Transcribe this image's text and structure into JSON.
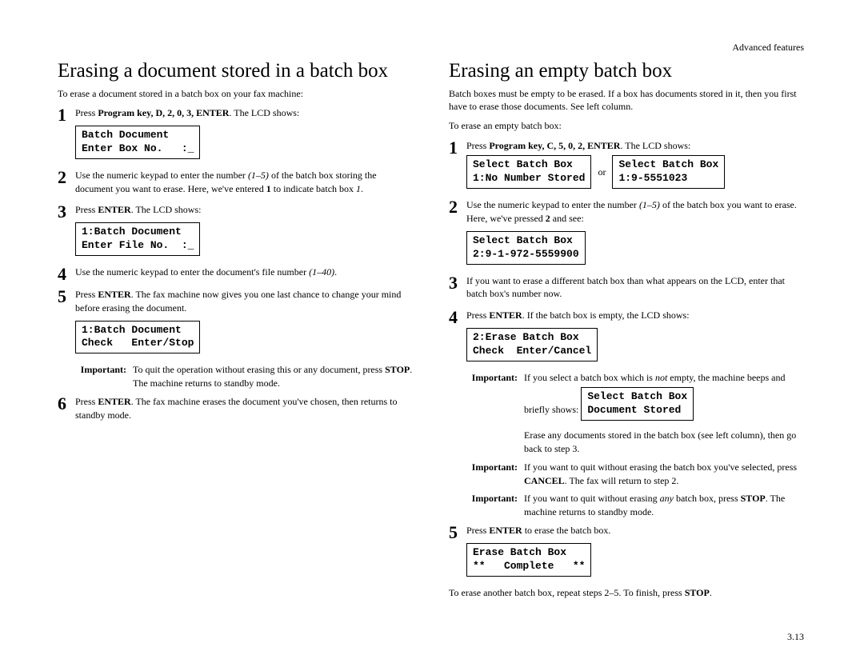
{
  "header": "Advanced features",
  "page_number": "3.13",
  "left": {
    "title": "Erasing a document stored in a batch box",
    "intro": "To erase a document stored in a batch box on your fax machine:",
    "step1_a": "Press ",
    "step1_b": "Program key, ",
    "step1_c": "D",
    "step1_d": ", 2, 0, 3, ",
    "step1_e": "ENTER",
    "step1_f": ". The ",
    "step1_g": "LCD",
    "step1_h": " shows:",
    "lcd1": "Batch Document\nEnter Box No.   :_",
    "step2_a": "Use the numeric keypad to enter the number ",
    "step2_b": "(1–5)",
    "step2_c": " of the batch box storing the document you want to erase. Here, we've entered ",
    "step2_d": "1",
    "step2_e": " to indicate batch box ",
    "step2_f": "1",
    "step2_g": ".",
    "step3_a": "Press ",
    "step3_b": "ENTER",
    "step3_c": ". The ",
    "step3_d": "LCD",
    "step3_e": " shows:",
    "lcd3": "1:Batch Document\nEnter File No.  :_",
    "step4_a": "Use the numeric keypad to enter the document's file number ",
    "step4_b": "(1–40)",
    "step4_c": ".",
    "step5_a": "Press ",
    "step5_b": "ENTER",
    "step5_c": ". The fax machine now gives you one last chance to change your mind before erasing the document.",
    "lcd5": "1:Batch Document\nCheck   Enter/Stop",
    "note1_label": "Important:",
    "note1_a": "To quit the operation without erasing this or any document, press ",
    "note1_b": "STOP",
    "note1_c": ". The machine returns to standby mode.",
    "step6_a": "Press ",
    "step6_b": "ENTER",
    "step6_c": ". The fax machine erases the document you've chosen, then returns to standby mode."
  },
  "right": {
    "title": "Erasing an empty batch box",
    "intro1": "Batch boxes must be empty to be erased. If a box has documents stored in it, then you first have to erase those documents. See left column.",
    "intro2": "To erase an empty batch box:",
    "step1_a": "Press ",
    "step1_b": "Program key, ",
    "step1_c": "C",
    "step1_d": ", 5, 0, 2, ",
    "step1_e": "ENTER",
    "step1_f": ". The ",
    "step1_g": "LCD",
    "step1_h": " shows:",
    "lcd1a": "Select Batch Box\n1:No Number Stored",
    "or": "or",
    "lcd1b": "Select Batch Box\n1:9-5551023",
    "step2_a": "Use the numeric keypad to enter the number ",
    "step2_b": "(1–5)",
    "step2_c": " of the batch box you want to erase. Here, we've pressed ",
    "step2_d": "2",
    "step2_e": " and see:",
    "lcd2": "Select Batch Box\n2:9-1-972-5559900",
    "step3_a": "If you want to erase a different batch box than what appears on the ",
    "step3_b": "LCD",
    "step3_c": ", enter that batch box's number now.",
    "step4_a": "Press ",
    "step4_b": "ENTER",
    "step4_c": ". If the batch box is empty, the ",
    "step4_d": "LCD",
    "step4_e": " shows:",
    "lcd4": "2:Erase Batch Box\nCheck  Enter/Cancel",
    "note1_label": "Important:",
    "note1_a": "If you select a batch box which is ",
    "note1_b": "not",
    "note1_c": " empty, the machine beeps and briefly shows:",
    "lcd_note": "Select Batch Box\nDocument Stored",
    "note_inline": "Erase any documents stored in the batch box (see left column), then go back to step 3.",
    "note2_label": "Important:",
    "note2_a": "If you want to quit without erasing the batch box you've selected, press ",
    "note2_b": "CANCEL",
    "note2_c": ". The fax will return to step 2.",
    "note3_label": "Important:",
    "note3_a": "If you want to quit without erasing ",
    "note3_b": "any",
    "note3_c": " batch box, press ",
    "note3_d": "STOP",
    "note3_e": ". The machine returns to standby mode.",
    "step5_a": "Press ",
    "step5_b": "ENTER",
    "step5_c": " to erase the batch box.",
    "lcd5": "Erase Batch Box\n**   Complete   **",
    "footer_a": "To erase another batch box, repeat steps 2–5. To finish, press ",
    "footer_b": "STOP",
    "footer_c": "."
  }
}
